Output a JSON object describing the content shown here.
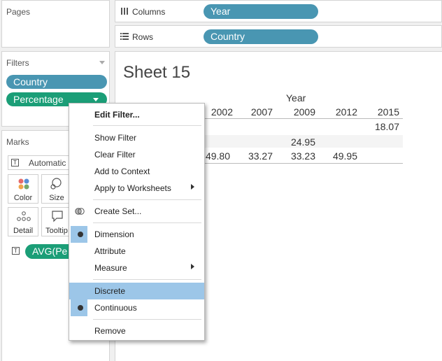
{
  "pages": {
    "title": "Pages"
  },
  "filters": {
    "title": "Filters",
    "pills": [
      "Country",
      "Percentage"
    ]
  },
  "marks": {
    "title": "Marks",
    "type": "Automatic",
    "buttons": {
      "color": "Color",
      "size": "Size",
      "detail": "Detail",
      "tooltip": "Tooltip"
    },
    "field_pill": "AVG(Pe"
  },
  "shelves": {
    "columns_label": "Columns",
    "columns_pill": "Year",
    "rows_label": "Rows",
    "rows_pill": "Country"
  },
  "sheet": {
    "title": "Sheet 15",
    "column_header": "Year",
    "years": [
      "2002",
      "2007",
      "2009",
      "2012",
      "2015"
    ],
    "rows": [
      [
        "",
        "",
        "",
        "",
        "18.07"
      ],
      [
        "",
        "",
        "24.95",
        "",
        ""
      ],
      [
        "49.80",
        "33.27",
        "33.23",
        "49.95",
        ""
      ]
    ]
  },
  "context_menu": {
    "edit_filter": "Edit Filter...",
    "show_filter": "Show Filter",
    "clear_filter": "Clear Filter",
    "add_to_context": "Add to Context",
    "apply_to_worksheets": "Apply to Worksheets",
    "create_set": "Create Set...",
    "dimension": "Dimension",
    "attribute": "Attribute",
    "measure": "Measure",
    "discrete": "Discrete",
    "continuous": "Continuous",
    "remove": "Remove"
  },
  "colors": {
    "dimension_pill": "#4996b2",
    "measure_pill": "#1b9e77",
    "menu_highlight": "#9cc6e8"
  }
}
